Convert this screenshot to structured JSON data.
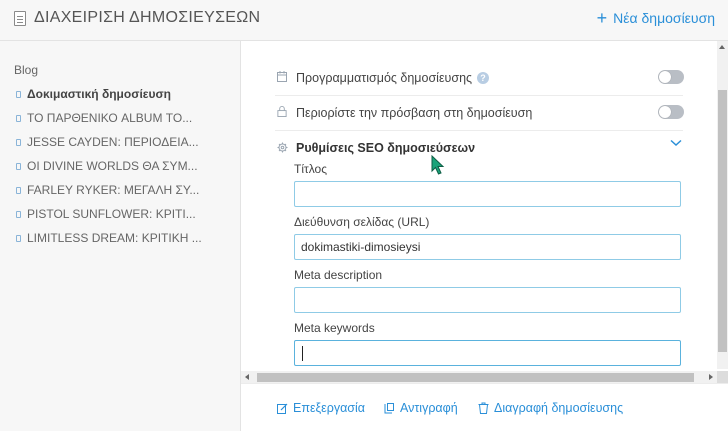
{
  "header": {
    "title": "ΔΙΑΧΕΙΡΙΣΗ ΔΗΜΟΣΙΕΥΣΕΩΝ",
    "new_post_label": "Νέα δημοσίευση"
  },
  "sidebar": {
    "blog_label": "Blog",
    "posts": [
      "Δοκιμαστική δημοσίευση",
      "ΤΟ ΠΑΡΘΕΝΙΚΟ ALBUM ΤΟ...",
      "JESSE CAYDEN: ΠΕΡΙΟΔΕΙΑ...",
      "ΟΙ DIVINE WORLDS ΘΑ ΣΥΜ...",
      "FARLEY RYKER: ΜΕΓΑΛΗ ΣΥ...",
      "PISTOL SUNFLOWER: ΚΡΙΤΙ...",
      "LIMITLESS DREAM: ΚΡΙΤΙΚΗ ..."
    ]
  },
  "settings": {
    "schedule_label": "Προγραμματισμός δημοσίευσης",
    "help_glyph": "?",
    "restrict_label": "Περιορίστε την πρόσβαση στη δημοσίευση",
    "seo_label": "Ρυθμίσεις SEO δημοσιεύσεων"
  },
  "seo": {
    "title_label": "Τίτλος",
    "title_value": "",
    "url_label": "Διεύθυνση σελίδας (URL)",
    "url_value": "dokimastiki-dimosieysi",
    "meta_description_label": "Meta description",
    "meta_description_value": "",
    "meta_keywords_label": "Meta keywords",
    "meta_keywords_value": ""
  },
  "actions": {
    "edit": "Επεξεργασία",
    "copy": "Αντιγραφή",
    "delete": "Διαγραφή δημοσίευσης"
  },
  "colors": {
    "accent": "#2a8fd8",
    "toggle_off": "#b9bec5",
    "field_border": "#8fcbe6",
    "cursor": "#1aa37a"
  }
}
